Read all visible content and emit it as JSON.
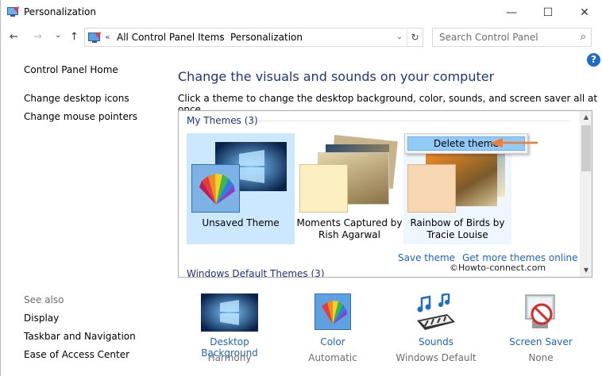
{
  "window": {
    "title": "Personalization",
    "controls": {
      "minimize": "—",
      "maximize": "☐",
      "close": "✕"
    }
  },
  "address": {
    "back": "←",
    "forward": "→",
    "recent": "⌄",
    "up": "↑",
    "overflow": "«",
    "breadcrumbs": [
      "All Control Panel Items",
      "Personalization"
    ],
    "separator": "›",
    "dropdown": "⌄",
    "refresh": "↻"
  },
  "search": {
    "placeholder": "Search Control Panel",
    "icon": "⌕"
  },
  "help": {
    "label": "?"
  },
  "sidebar": {
    "home": "Control Panel Home",
    "links": [
      "Change desktop icons",
      "Change mouse pointers"
    ],
    "see_also_label": "See also",
    "see_also": [
      "Display",
      "Taskbar and Navigation",
      "Ease of Access Center"
    ]
  },
  "main": {
    "heading": "Change the visuals and sounds on your computer",
    "subheading": "Click a theme to change the desktop background, color, sounds, and screen saver all at once.",
    "my_themes_label": "My Themes (3)",
    "themes": [
      {
        "name": "Unsaved Theme",
        "selected": true
      },
      {
        "name": "Moments Captured by Rish Agarwal",
        "selected": false
      },
      {
        "name": "Rainbow of Birds by Tracie Louise",
        "selected": false
      }
    ],
    "save_theme": "Save theme",
    "get_more": "Get more themes online",
    "windows_default_label": "Windows Default Themes (3)",
    "context_menu_item": "Delete theme",
    "scroll_up": "▲",
    "scroll_down": "▼"
  },
  "watermark": "©Howto-connect.com",
  "bottom": [
    {
      "name": "Desktop Background",
      "value": "Harmony"
    },
    {
      "name": "Color",
      "value": "Automatic"
    },
    {
      "name": "Sounds",
      "value": "Windows Default"
    },
    {
      "name": "Screen Saver",
      "value": "None"
    }
  ],
  "colors": {
    "accent_link": "#1e64c8",
    "heading": "#1e3287",
    "selection": "#cce8ff",
    "arrow": "#f07d32"
  }
}
